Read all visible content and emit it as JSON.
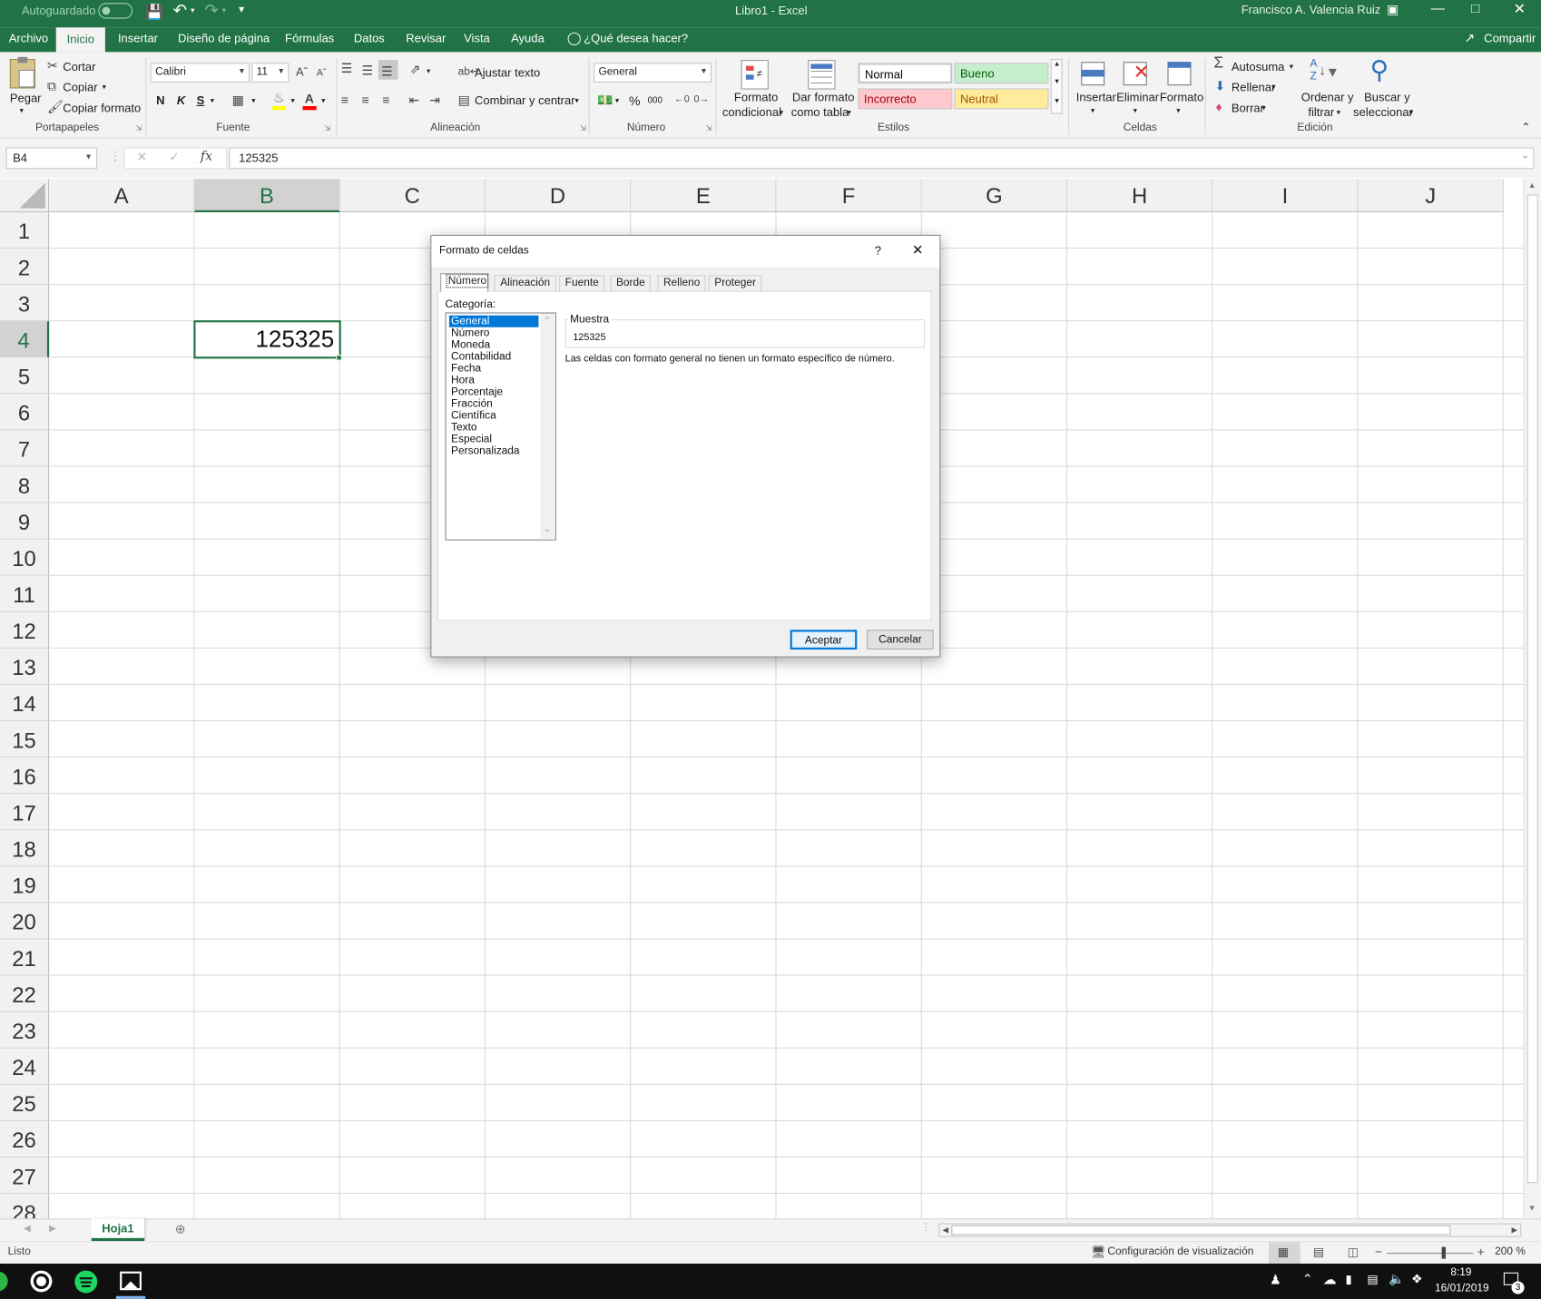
{
  "titlebar": {
    "autosave_label": "Autoguardado",
    "autosave_state": "Desactivado",
    "doc_title": "Libro1  -  Excel",
    "user": "Francisco A. Valencia Ruiz"
  },
  "menu": {
    "tabs": [
      "Archivo",
      "Inicio",
      "Insertar",
      "Diseño de página",
      "Fórmulas",
      "Datos",
      "Revisar",
      "Vista",
      "Ayuda"
    ],
    "tell_me": "¿Qué desea hacer?",
    "share": "Compartir"
  },
  "ribbon": {
    "clipboard": {
      "paste": "Pegar",
      "cut": "Cortar",
      "copy": "Copiar",
      "format_painter": "Copiar formato",
      "label": "Portapapeles"
    },
    "font": {
      "name": "Calibri",
      "size": "11",
      "bold": "N",
      "italic": "K",
      "underline": "S",
      "label": "Fuente"
    },
    "alignment": {
      "wrap": "Ajustar texto",
      "merge": "Combinar y centrar",
      "label": "Alineación"
    },
    "number": {
      "format": "General",
      "percent": "%",
      "thousands": "000",
      "label": "Número"
    },
    "styles": {
      "cond_format_1": "Formato",
      "cond_format_2": "condicional",
      "table_format_1": "Dar formato",
      "table_format_2": "como tabla",
      "normal": "Normal",
      "good": "Bueno",
      "bad": "Incorrecto",
      "neutral": "Neutral",
      "label": "Estilos"
    },
    "cells": {
      "insert": "Insertar",
      "delete": "Eliminar",
      "format": "Formato",
      "label": "Celdas"
    },
    "editing": {
      "autosum": "Autosuma",
      "fill": "Rellenar",
      "clear": "Borrar",
      "sort_1": "Ordenar y",
      "sort_2": "filtrar",
      "find_1": "Buscar y",
      "find_2": "seleccionar",
      "label": "Edición"
    }
  },
  "formula_bar": {
    "name_box": "B4",
    "fx": "fx",
    "value": "125325"
  },
  "grid": {
    "columns": [
      "A",
      "B",
      "C",
      "D",
      "E",
      "F",
      "G",
      "H",
      "I",
      "J"
    ],
    "rows": [
      "1",
      "2",
      "3",
      "4",
      "5",
      "6",
      "7",
      "8",
      "9",
      "10",
      "11",
      "12",
      "13",
      "14",
      "15",
      "16",
      "17",
      "18",
      "19",
      "20",
      "21",
      "22",
      "23",
      "24",
      "25",
      "26",
      "27",
      "28"
    ],
    "active_cell": {
      "ref": "B4",
      "value": "125325"
    }
  },
  "dialog": {
    "title": "Formato de celdas",
    "help": "?",
    "close": "✕",
    "tabs": [
      "Número",
      "Alineación",
      "Fuente",
      "Borde",
      "Relleno",
      "Proteger"
    ],
    "category_label": "Categoría:",
    "categories": [
      "General",
      "Número",
      "Moneda",
      "Contabilidad",
      "Fecha",
      "Hora",
      "Porcentaje",
      "Fracción",
      "Científica",
      "Texto",
      "Especial",
      "Personalizada"
    ],
    "selected_category": "General",
    "sample_label": "Muestra",
    "sample_value": "125325",
    "description": "Las celdas con formato general no tienen un formato específico de número.",
    "ok": "Aceptar",
    "cancel": "Cancelar"
  },
  "sheets": {
    "tabs": [
      "Hoja1"
    ],
    "active": "Hoja1"
  },
  "status": {
    "ready": "Listo",
    "display_settings": "Configuración de visualización",
    "zoom": "200 %"
  },
  "taskbar": {
    "time": "8:19",
    "date": "16/01/2019",
    "notifications": "3"
  },
  "colors": {
    "excel_green": "#217346",
    "ribbon_bg": "#f3f3f3",
    "selection": "#0078d7"
  }
}
